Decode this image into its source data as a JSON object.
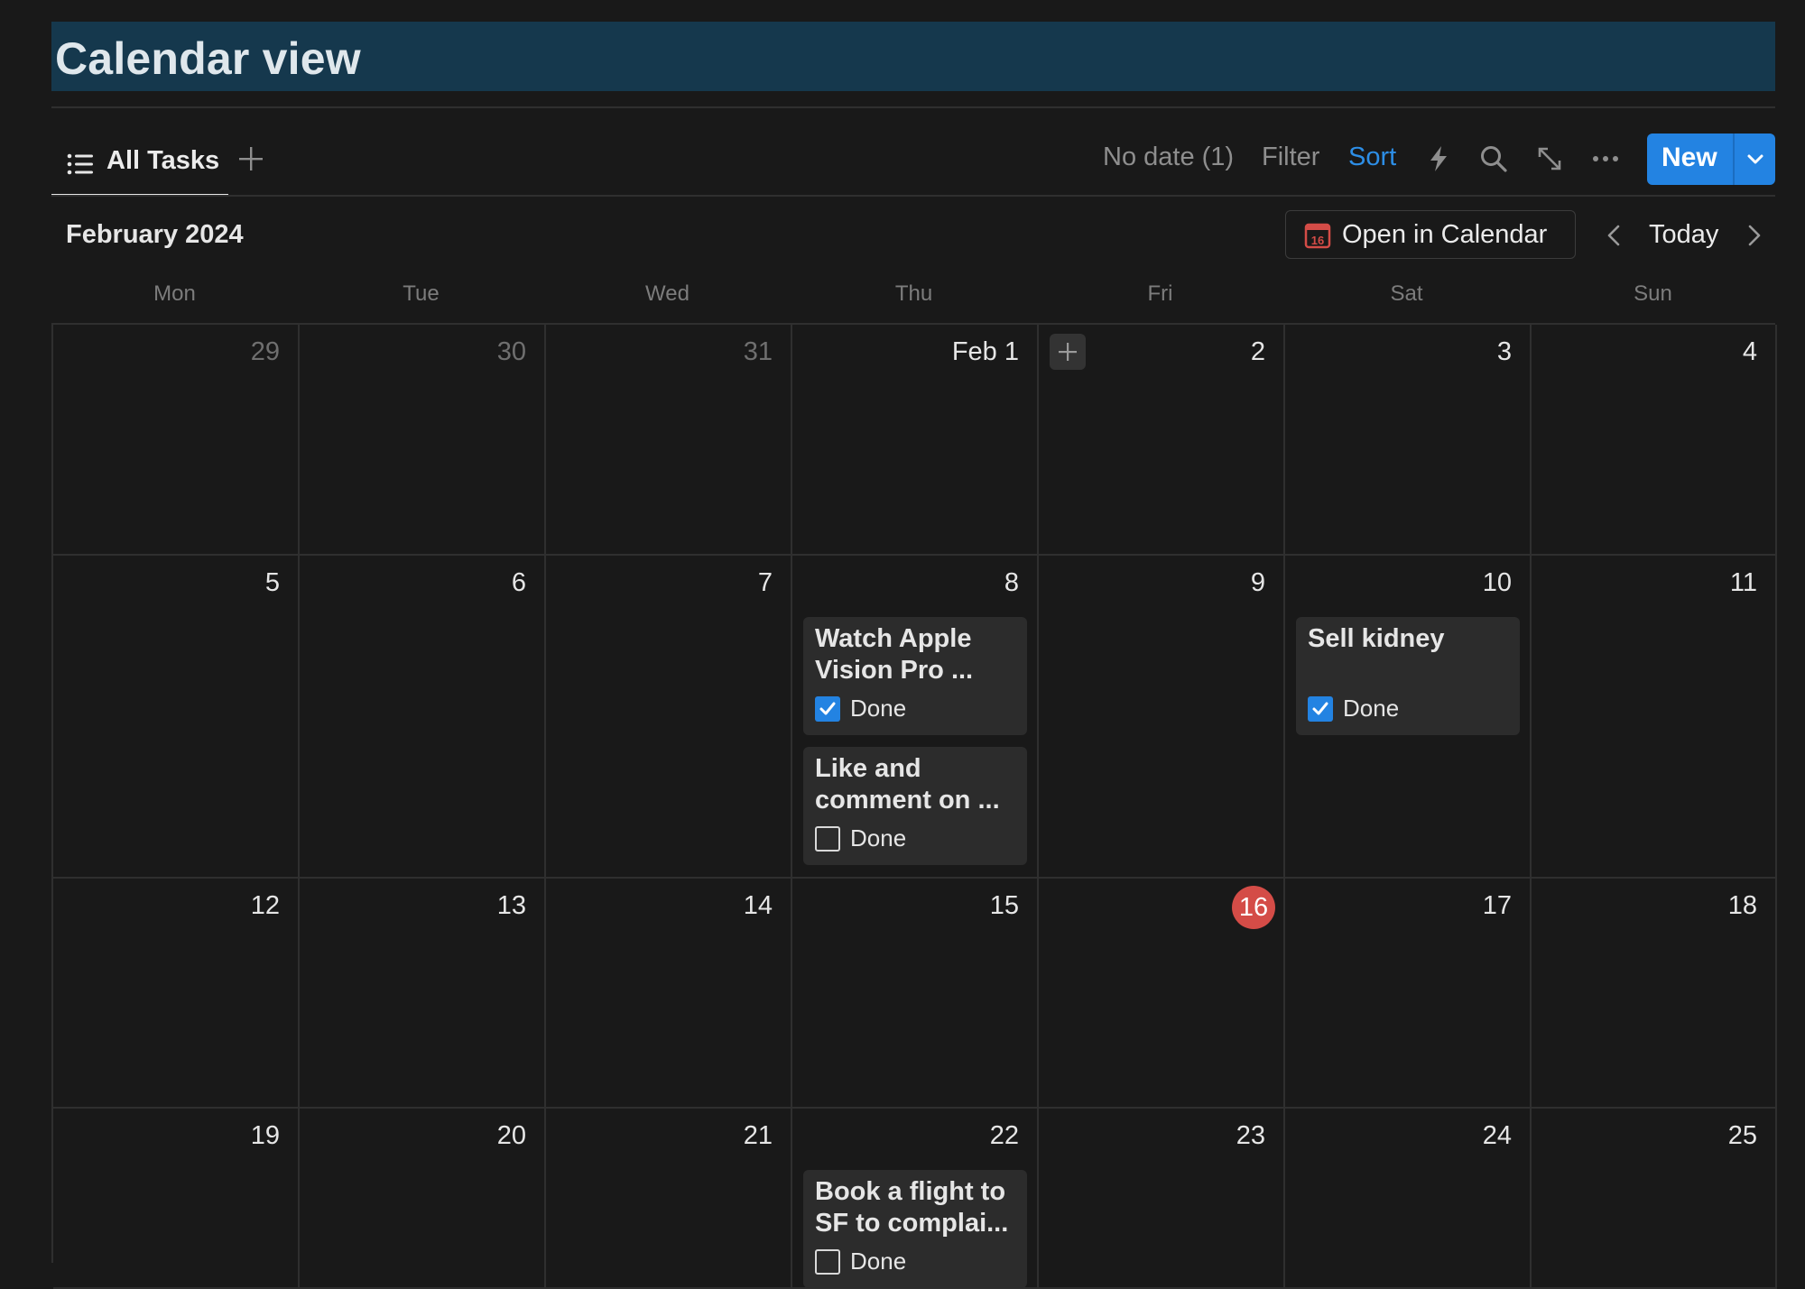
{
  "page": {
    "title": "Calendar view"
  },
  "toolbar": {
    "tab_label": "All Tasks",
    "no_date": "No date (1)",
    "filter": "Filter",
    "sort": "Sort",
    "new_label": "New",
    "icons": [
      "list-icon",
      "plus-icon",
      "lightning-icon",
      "search-icon",
      "expand-icon",
      "more-icon",
      "chevron-down-icon"
    ],
    "accent_color": "#2383e2"
  },
  "header": {
    "month": "February 2024",
    "open_in_calendar": "Open in Calendar",
    "calendar_icon_text": "16",
    "today": "Today"
  },
  "weekdays": [
    "Mon",
    "Tue",
    "Wed",
    "Thu",
    "Fri",
    "Sat",
    "Sun"
  ],
  "weeks": [
    [
      "29",
      "30",
      "31",
      "Feb 1",
      "2",
      "3",
      "4"
    ],
    [
      "5",
      "6",
      "7",
      "8",
      "9",
      "10",
      "11"
    ],
    [
      "12",
      "13",
      "14",
      "15",
      "16",
      "17",
      "18"
    ],
    [
      "19",
      "20",
      "21",
      "22",
      "23",
      "24",
      "25"
    ]
  ],
  "today_date": "16",
  "today_color": "#d44c47",
  "tasks": [
    {
      "title": "Watch Apple Vision Pro ...",
      "done_label": "Done",
      "checked": true
    },
    {
      "title": "Like and comment on ...",
      "done_label": "Done",
      "checked": false
    },
    {
      "title": "Sell kidney",
      "done_label": "Done",
      "checked": true
    },
    {
      "title": "Book a flight to SF to complai...",
      "done_label": "Done",
      "checked": false
    }
  ]
}
